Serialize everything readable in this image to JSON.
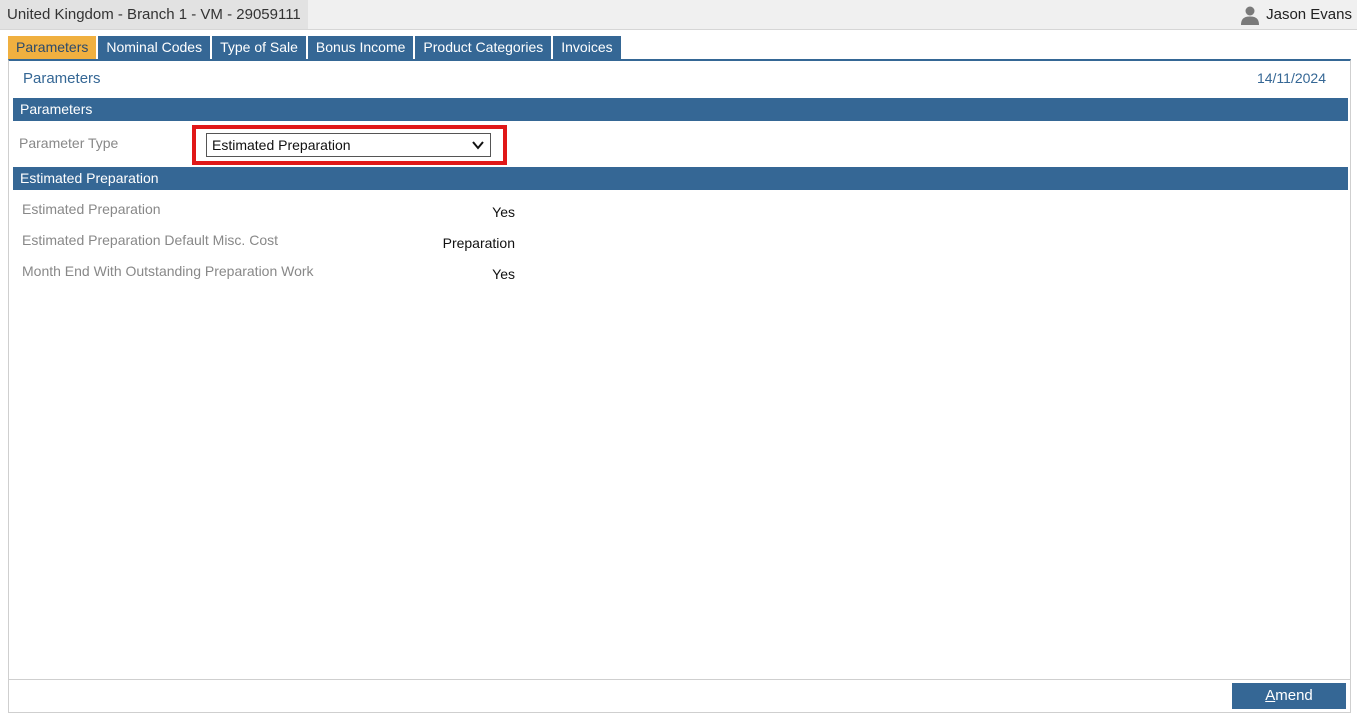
{
  "topbar": {
    "branch": "United Kingdom - Branch 1 - VM - 29059111",
    "user_name": "Jason Evans",
    "user_icon": "person-icon"
  },
  "tabs": [
    {
      "label": "Parameters",
      "active": true
    },
    {
      "label": "Nominal Codes",
      "active": false
    },
    {
      "label": "Type of Sale",
      "active": false
    },
    {
      "label": "Bonus Income",
      "active": false
    },
    {
      "label": "Product Categories",
      "active": false
    },
    {
      "label": "Invoices",
      "active": false
    }
  ],
  "page": {
    "title": "Parameters",
    "date": "14/11/2024"
  },
  "parameters_section": {
    "header": "Parameters",
    "parameter_type_label": "Parameter Type",
    "parameter_type_value": "Estimated Preparation"
  },
  "details_section": {
    "header": "Estimated Preparation",
    "rows": [
      {
        "label": "Estimated Preparation",
        "value": "Yes"
      },
      {
        "label": "Estimated Preparation Default Misc. Cost",
        "value": "Preparation"
      },
      {
        "label": "Month End With Outstanding Preparation Work",
        "value": "Yes"
      }
    ]
  },
  "footer": {
    "amend_first_letter": "A",
    "amend_rest": "mend"
  },
  "colors": {
    "accent": "#356795",
    "active_tab": "#f0b040",
    "highlight": "#e01818"
  }
}
